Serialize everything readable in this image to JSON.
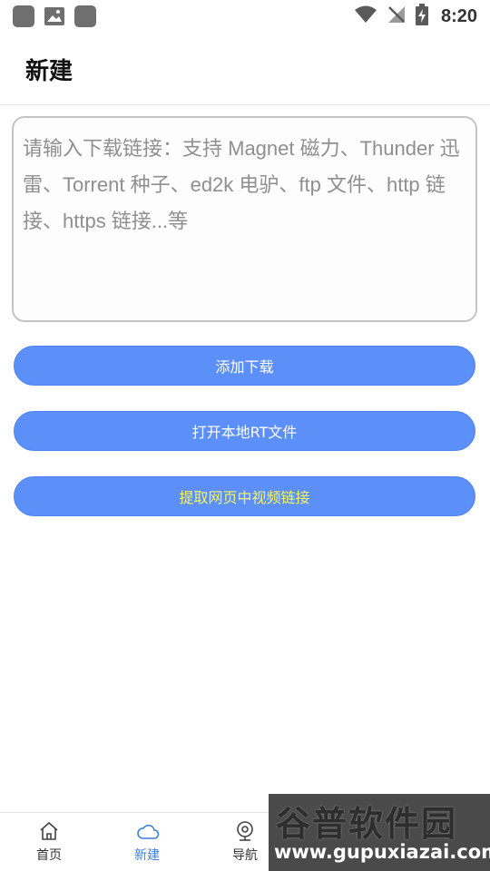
{
  "status_bar": {
    "time": "8:20"
  },
  "header": {
    "title": "新建"
  },
  "link_input": {
    "placeholder": "请输入下载链接：支持 Magnet 磁力、Thunder 迅雷、Torrent 种子、ed2k 电驴、ftp 文件、http 链接、https 链接...等"
  },
  "buttons": {
    "add_download": "添加下载",
    "open_local": "打开本地RT文件",
    "extract_video": "提取网页中视频链接"
  },
  "bottom_nav": [
    {
      "label": "首页",
      "icon": "home-icon"
    },
    {
      "label": "新建",
      "icon": "cloud-icon",
      "active": true
    },
    {
      "label": "导航",
      "icon": "compass-icon"
    }
  ],
  "watermark": {
    "title": "谷普软件园",
    "url": "www.gupuxiazai.com"
  },
  "colors": {
    "accent": "#5c8ff8",
    "active_nav": "#3c7fd6",
    "highlight_text": "#f6f55a"
  }
}
